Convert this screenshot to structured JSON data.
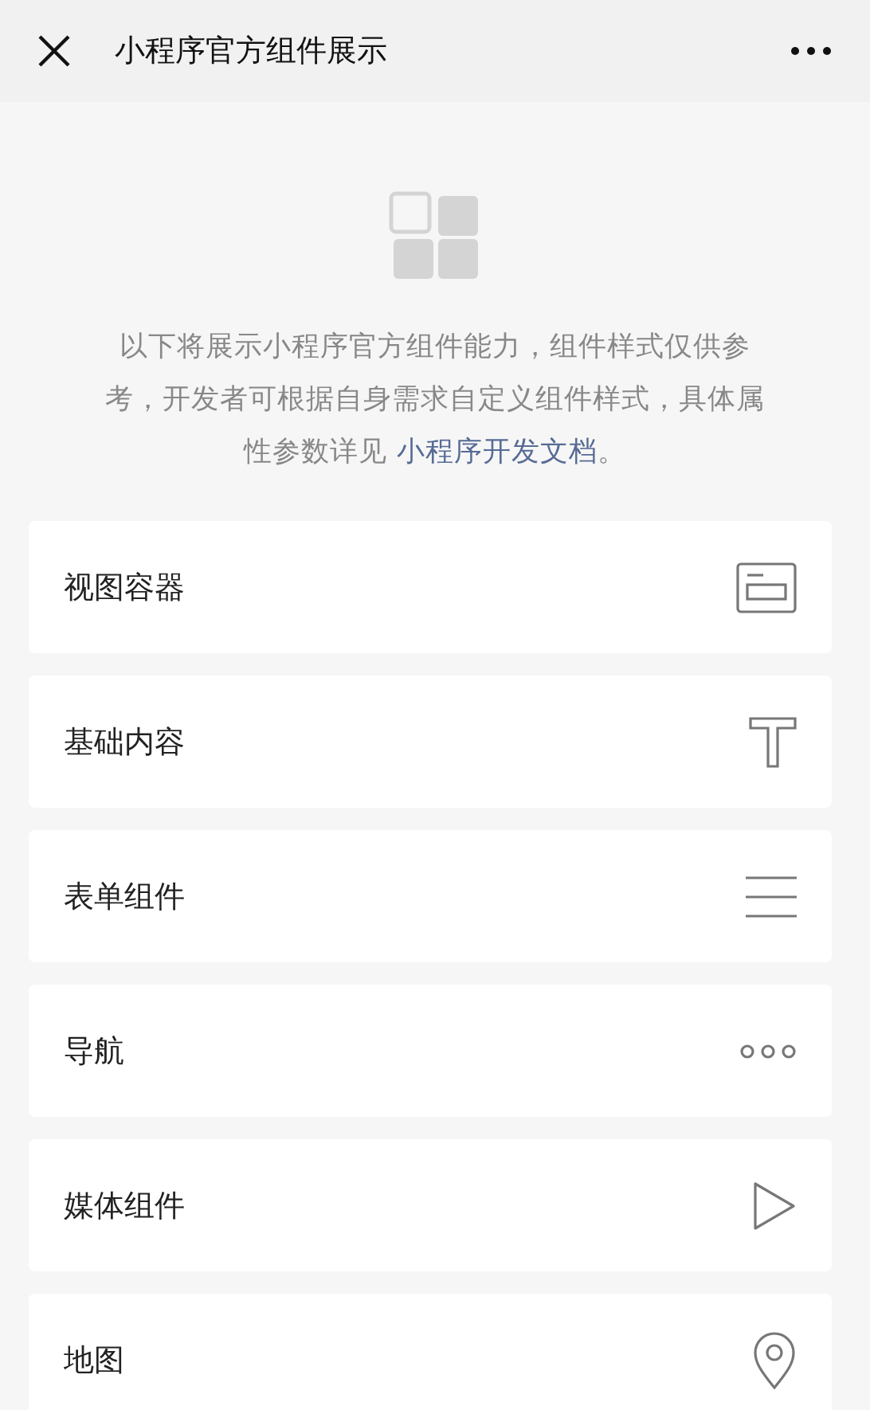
{
  "header": {
    "title": "小程序官方组件展示"
  },
  "intro": {
    "text": "以下将展示小程序官方组件能力，组件样式仅供参考，开发者可根据自身需求自定义组件样式，具体属性参数详见 ",
    "link": "小程序开发文档",
    "after": "。"
  },
  "items": [
    {
      "label": "视图容器",
      "kind": "container"
    },
    {
      "label": "基础内容",
      "kind": "text"
    },
    {
      "label": "表单组件",
      "kind": "form"
    },
    {
      "label": "导航",
      "kind": "nav"
    },
    {
      "label": "媒体组件",
      "kind": "media"
    },
    {
      "label": "地图",
      "kind": "map"
    }
  ]
}
